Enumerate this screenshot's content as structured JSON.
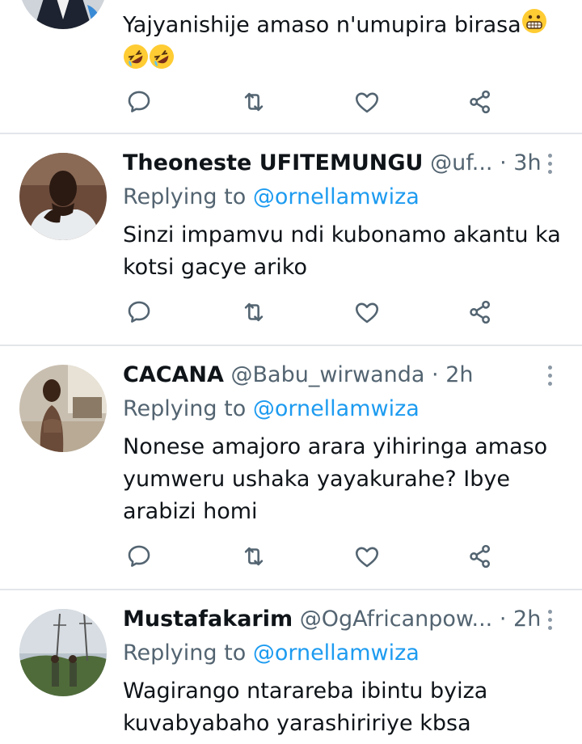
{
  "tweets": [
    {
      "name": "",
      "handle": "",
      "time": "",
      "replying_prefix": "",
      "replying_mention": "",
      "text_lines": [
        "Yajyanishije amaso n'umupira birasa"
      ],
      "emoji": [
        "grimacing-face",
        "rolling-laughing-face",
        "rolling-laughing-face"
      ]
    },
    {
      "name": "Theoneste UFITEMUNGU",
      "handle": "@uf...",
      "dot": "·",
      "time": "3h",
      "replying_prefix": "Replying to",
      "replying_mention": "@ornellamwiza",
      "text_lines": [
        "Sinzi impamvu ndi kubonamo akantu ka",
        "kotsi gacye ariko"
      ]
    },
    {
      "name": "CACANA",
      "handle": "@Babu_wirwanda",
      "dot": "·",
      "time": "2h",
      "replying_prefix": "Replying to",
      "replying_mention": "@ornellamwiza",
      "text_lines": [
        "Nonese amajoro arara yihiringa amaso",
        "yumweru ushaka yayakurahe? Ibye",
        "arabizi homi"
      ]
    },
    {
      "name": "Mustafakarim",
      "handle": "@OgAfricanpow...",
      "dot": "·",
      "time": "2h",
      "replying_prefix": "Replying to",
      "replying_mention": "@ornellamwiza",
      "text_lines": [
        "Wagirango ntarareba ibintu byiza",
        "kuvabyabaho yarashiririye kbsa"
      ]
    }
  ],
  "icons": {
    "reply": "speech-bubble-icon",
    "retweet": "retweet-icon",
    "like": "heart-icon",
    "share": "share-icon",
    "more": "more-vertical-icon"
  },
  "colors": {
    "link": "#1d9bf0",
    "secondary_text": "#536471",
    "primary_text": "#0f1419",
    "divider": "#e3e6e9"
  }
}
